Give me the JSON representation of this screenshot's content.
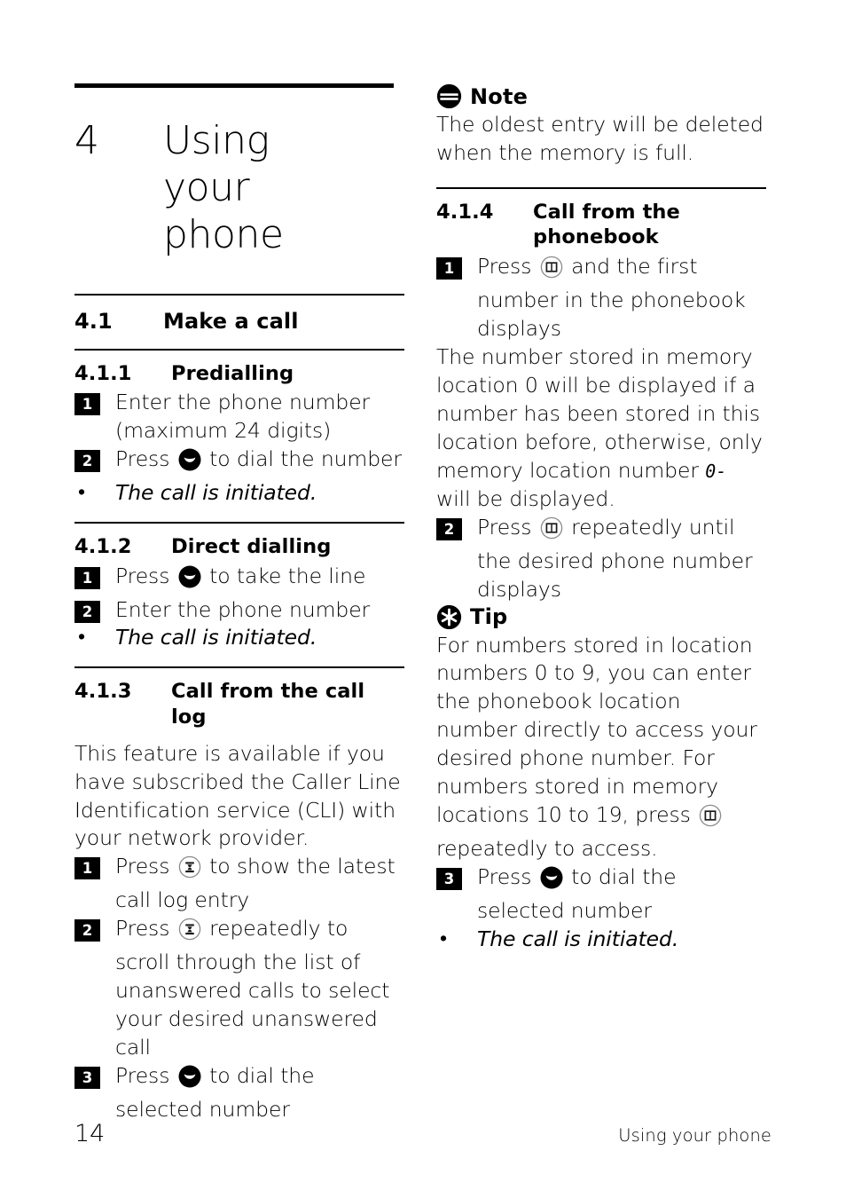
{
  "chapter": {
    "number": "4",
    "title": "Using your phone"
  },
  "left_column": {
    "section_4_1": {
      "number": "4.1",
      "title": "Make a call"
    },
    "section_4_1_1": {
      "number": "4.1.1",
      "title": "Predialling",
      "steps": [
        {
          "badge": "1",
          "text_before": "Enter the phone number (maximum 24 digits)",
          "icon": null,
          "text_after": ""
        },
        {
          "badge": "2",
          "text_before": "Press ",
          "icon": "talk-button-icon",
          "text_after": " to dial the number"
        }
      ],
      "bullet": "The call is initiated."
    },
    "section_4_1_2": {
      "number": "4.1.2",
      "title": "Direct dialling",
      "steps": [
        {
          "badge": "1",
          "text_before": "Press ",
          "icon": "talk-button-icon",
          "text_after": " to take the line"
        },
        {
          "badge": "2",
          "text_before": "Enter the phone number",
          "icon": null,
          "text_after": ""
        }
      ],
      "bullet": "The call is initiated."
    },
    "section_4_1_3": {
      "number": "4.1.3",
      "title": "Call from the call log",
      "intro": "This feature is available if you have subscribed the Caller Line Identification service (CLI) with your network provider.",
      "steps": [
        {
          "badge": "1",
          "text_before": "Press ",
          "icon": "call-log-key-icon",
          "text_after": " to show the latest call log entry"
        },
        {
          "badge": "2",
          "text_before": "Press ",
          "icon": "call-log-key-icon",
          "text_after": " repeatedly to scroll through the list of unanswered calls to select your desired unanswered call"
        },
        {
          "badge": "3",
          "text_before": "Press ",
          "icon": "talk-button-icon",
          "text_after": " to dial the selected number"
        }
      ]
    }
  },
  "right_column": {
    "note": {
      "icon": "note-icon",
      "label": "Note",
      "text": "The oldest entry will be deleted when the memory is full."
    },
    "section_4_1_4": {
      "number": "4.1.4",
      "title": "Call from the phonebook",
      "step1": {
        "badge": "1",
        "text_before": "Press ",
        "icon": "phonebook-key-icon",
        "text_after": " and the first number in the phonebook displays"
      },
      "paragraph_before_lcd": "The number stored in memory location 0 will be displayed if a number has been stored in this location before, otherwise, only memory location number ",
      "lcd_glyph": "0-",
      "paragraph_after_lcd": " will be displayed.",
      "step2": {
        "badge": "2",
        "text_before": "Press ",
        "icon": "phonebook-key-icon",
        "text_after": " repeatedly until the desired phone number displays"
      }
    },
    "tip": {
      "icon": "tip-icon",
      "label": "Tip",
      "text_before_icon": "For numbers stored in location numbers 0 to 9, you can enter the phonebook location number directly to access your desired phone number. For numbers stored in memory locations 10 to 19, press ",
      "icon_inline": "phonebook-key-icon",
      "text_after_icon": " repeatedly to access."
    },
    "step3": {
      "badge": "3",
      "text_before": "Press ",
      "icon": "talk-button-icon",
      "text_after": " to dial the selected number"
    },
    "bullet": "The call is initiated."
  },
  "footer": {
    "page_number": "14",
    "running_head": "Using your phone"
  },
  "colors": {
    "text": "#000000",
    "background": "#ffffff",
    "badge_bg": "#000000",
    "badge_text": "#ffffff",
    "icon_outline": "#6e6e6e"
  }
}
